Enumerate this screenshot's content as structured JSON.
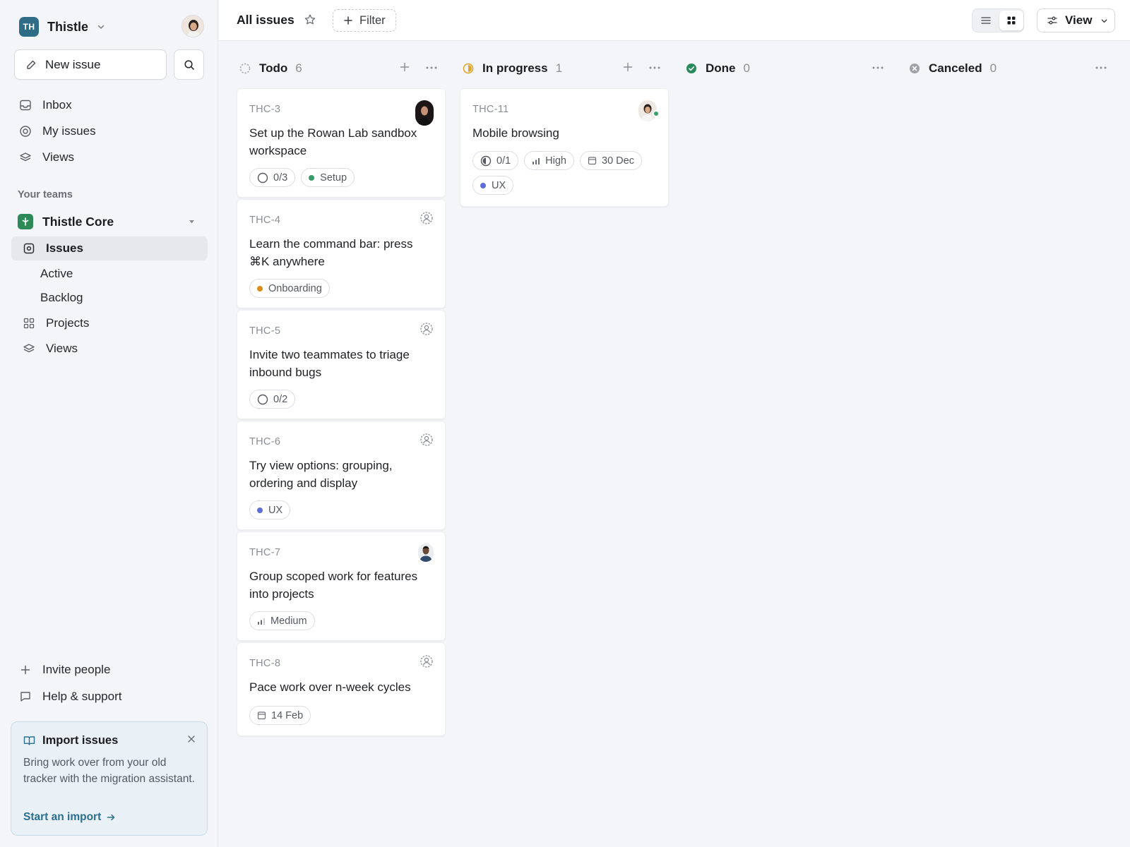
{
  "workspace": {
    "initials": "TH",
    "name": "Thistle"
  },
  "sidebar": {
    "new_issue": "New issue",
    "top_nav": [
      {
        "label": "Inbox",
        "icon": "inbox-icon"
      },
      {
        "label": "My issues",
        "icon": "target-icon"
      },
      {
        "label": "Views",
        "icon": "layers-icon"
      }
    ],
    "teams_label": "Your teams",
    "team": {
      "name": "Thistle Core"
    },
    "team_nav": {
      "issues": "Issues",
      "active": "Active",
      "backlog": "Backlog",
      "projects": "Projects",
      "views": "Views"
    },
    "bottom": {
      "invite": "Invite people",
      "help": "Help & support"
    },
    "import_card": {
      "title": "Import issues",
      "body": "Bring work over from your old tracker with the migration assistant.",
      "link": "Start an import"
    }
  },
  "header": {
    "title": "All issues",
    "filter": "Filter",
    "view": "View"
  },
  "board": {
    "columns": [
      {
        "name": "Todo",
        "count": "6",
        "status_color": "#9ea1a8"
      },
      {
        "name": "In progress",
        "count": "1",
        "status_color": "#e0a526"
      },
      {
        "name": "Done",
        "count": "0",
        "status_color": "#2b8a5b"
      },
      {
        "name": "Canceled",
        "count": "0",
        "status_color": "#9ea1a8"
      }
    ],
    "todo_cards": [
      {
        "id": "THC-3",
        "title": "Set up the Rowan Lab sandbox workspace",
        "chips": [
          "0/3",
          "Setup"
        ]
      },
      {
        "id": "THC-4",
        "title": "Learn the command bar: press ⌘K anywhere",
        "chips": [
          "Onboarding"
        ]
      },
      {
        "id": "THC-5",
        "title": "Invite two teammates to triage inbound bugs",
        "chips": [
          "0/2"
        ]
      },
      {
        "id": "THC-6",
        "title": "Try view options: grouping, ordering and display",
        "chips": [
          "UX"
        ]
      },
      {
        "id": "THC-7",
        "title": "Group scoped work for features into projects",
        "chips": [
          "Medium"
        ]
      },
      {
        "id": "THC-8",
        "title": "Pace work over n-week cycles",
        "chips": [
          "14 Feb"
        ]
      }
    ],
    "progress_cards": [
      {
        "id": "THC-11",
        "title": "Mobile browsing",
        "chips": [
          "0/1",
          "High",
          "30 Dec",
          "UX"
        ]
      }
    ]
  },
  "colors": {
    "setup": "#3a9a6e",
    "onboarding": "#d9901a",
    "ux": "#5b6fd6",
    "accent": "#2a6f8e"
  }
}
